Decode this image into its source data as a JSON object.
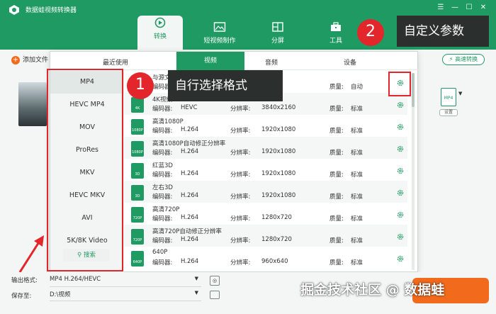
{
  "app": {
    "title": "数据蛙视频转换器",
    "window_controls": [
      "☰",
      "—",
      "☐",
      "✕"
    ]
  },
  "nav": {
    "tabs": [
      {
        "label": "转换",
        "icon": "convert-icon"
      },
      {
        "label": "短视频制作",
        "icon": "image-icon"
      },
      {
        "label": "分屏",
        "icon": "split-screen-icon"
      },
      {
        "label": "工具",
        "icon": "toolbox-icon"
      }
    ],
    "active": "转换"
  },
  "toolbar": {
    "add_file": "添加文件",
    "fast_convert": "高速转换",
    "format_card": "MP4",
    "format_settings": "设置"
  },
  "popup": {
    "categories": [
      "最近使用",
      "视频",
      "音频",
      "设备"
    ],
    "active_category": "视频",
    "formats": [
      "MP4",
      "HEVC MP4",
      "MOV",
      "ProRes",
      "MKV",
      "HEVC MKV",
      "AVI",
      "5K/8K Video"
    ],
    "selected_format": "MP4",
    "search": "搜索",
    "labels": {
      "encoder": "编码器:",
      "resolution": "分辨率:",
      "quality": "质量:"
    },
    "presets": [
      {
        "name": "与源文件相同",
        "icon_text": "",
        "encoder": "",
        "resolution": "",
        "quality": "自动"
      },
      {
        "name": "4K视频",
        "icon_text": "4K",
        "encoder": "HEVC",
        "resolution": "3840x2160",
        "quality": "标准"
      },
      {
        "name": "高清1080P",
        "icon_text": "1080P",
        "encoder": "H.264",
        "resolution": "1920x1080",
        "quality": "标准"
      },
      {
        "name": "高清1080P自动修正分辨率",
        "icon_text": "1080P",
        "encoder": "H.264",
        "resolution": "1920x1080",
        "quality": "标准"
      },
      {
        "name": "红蓝3D",
        "icon_text": "3D",
        "encoder": "H.264",
        "resolution": "1920x1080",
        "quality": "标准"
      },
      {
        "name": "左右3D",
        "icon_text": "3D",
        "encoder": "H.264",
        "resolution": "1920x1080",
        "quality": "标准"
      },
      {
        "name": "高清720P",
        "icon_text": "720P",
        "encoder": "H.264",
        "resolution": "1280x720",
        "quality": "标准"
      },
      {
        "name": "高清720P自动修正分辨率",
        "icon_text": "720P",
        "encoder": "H.264",
        "resolution": "1280x720",
        "quality": "标准"
      },
      {
        "name": "640P",
        "icon_text": "640P",
        "encoder": "H.264",
        "resolution": "960x640",
        "quality": "标准"
      }
    ]
  },
  "annotations": {
    "badge1": "1",
    "callout1": "自行选择格式",
    "badge2": "2",
    "callout2": "自定义参数"
  },
  "bottom": {
    "output_label": "输出格式:",
    "output_value": "MP4 H.264/HEVC",
    "save_label": "保存至:",
    "save_value": "D:\\视频"
  },
  "watermark": "掘金技术社区 @ 数据蛙",
  "colors": {
    "primary": "#1f9a63",
    "accent": "#f26a1b",
    "highlight": "#e3262b"
  }
}
